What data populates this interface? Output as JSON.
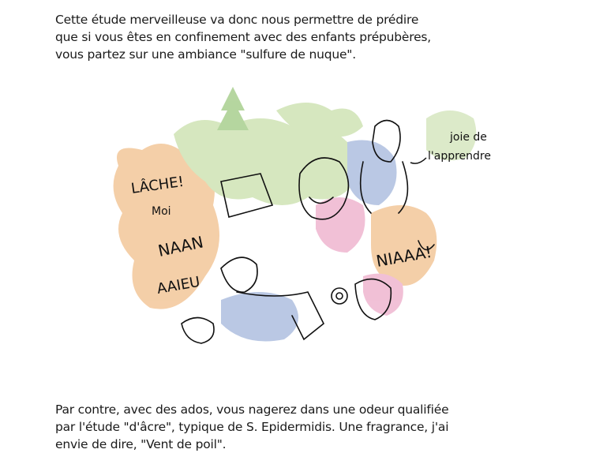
{
  "intro_text": {
    "lines": [
      "Cette étude merveilleuse va donc nous permettre de prédire",
      "que si vous êtes en confinement avec des enfants prépubères,",
      "vous partez sur une ambiance \"sulfure de nuque\"."
    ]
  },
  "illustration": {
    "annotation_line1": "joie de",
    "annotation_line2": "l'apprendre",
    "shout_1": "LÂCHE!",
    "shout_2": "Moi",
    "shout_3": "NAAN",
    "shout_4": "AAIEU",
    "shout_5": "NIAAA!"
  },
  "outro_text": {
    "lines": [
      "Par contre, avec des ados, vous nagerez dans une odeur qualifiée",
      "par l'étude \"d'âcre\", typique de S. Epidermidis. Une fragrance, j'ai",
      "envie de dire, \"Vent de poil\"."
    ]
  },
  "colors": {
    "orange": "#f3c79a",
    "green": "#cfe3b4",
    "pink": "#efb6d0",
    "blue": "#aebfe0",
    "ink": "#111111"
  }
}
